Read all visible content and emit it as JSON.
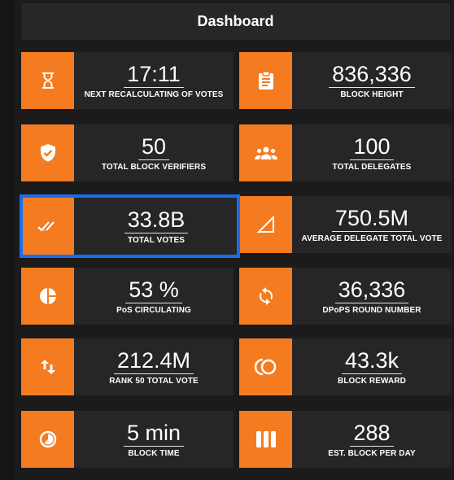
{
  "header": {
    "title": "Dashboard"
  },
  "colors": {
    "accent": "#f47b20",
    "card_bg": "#262626",
    "selection": "#1a6cf0"
  },
  "cards": [
    {
      "value": "17:11",
      "label": "NEXT RECALCULATING OF VOTES",
      "icon": "hourglass-icon"
    },
    {
      "value": "836,336",
      "label": "BLOCK HEIGHT",
      "icon": "clipboard-icon"
    },
    {
      "value": "50",
      "label": "TOTAL BLOCK VERIFIERS",
      "icon": "shield-check-icon"
    },
    {
      "value": "100",
      "label": "TOTAL DELEGATES",
      "icon": "people-icon"
    },
    {
      "value": "33.8B",
      "label": "TOTAL VOTES",
      "icon": "double-check-icon",
      "selected": true
    },
    {
      "value": "750.5M",
      "label": "AVERAGE DELEGATE TOTAL VOTE",
      "icon": "triangle-icon"
    },
    {
      "value": "53 %",
      "label": "PoS CIRCULATING",
      "icon": "pie-chart-icon"
    },
    {
      "value": "36,336",
      "label": "DPoPS ROUND NUMBER",
      "icon": "refresh-icon"
    },
    {
      "value": "212.4M",
      "label": "RANK 50 TOTAL VOTE",
      "icon": "swap-vert-icon"
    },
    {
      "value": "43.3k",
      "label": "BLOCK REWARD",
      "icon": "coins-icon"
    },
    {
      "value": "5 min",
      "label": "BLOCK TIME",
      "icon": "clock-icon"
    },
    {
      "value": "288",
      "label": "EST. BLOCK PER DAY",
      "icon": "bars-icon"
    }
  ]
}
